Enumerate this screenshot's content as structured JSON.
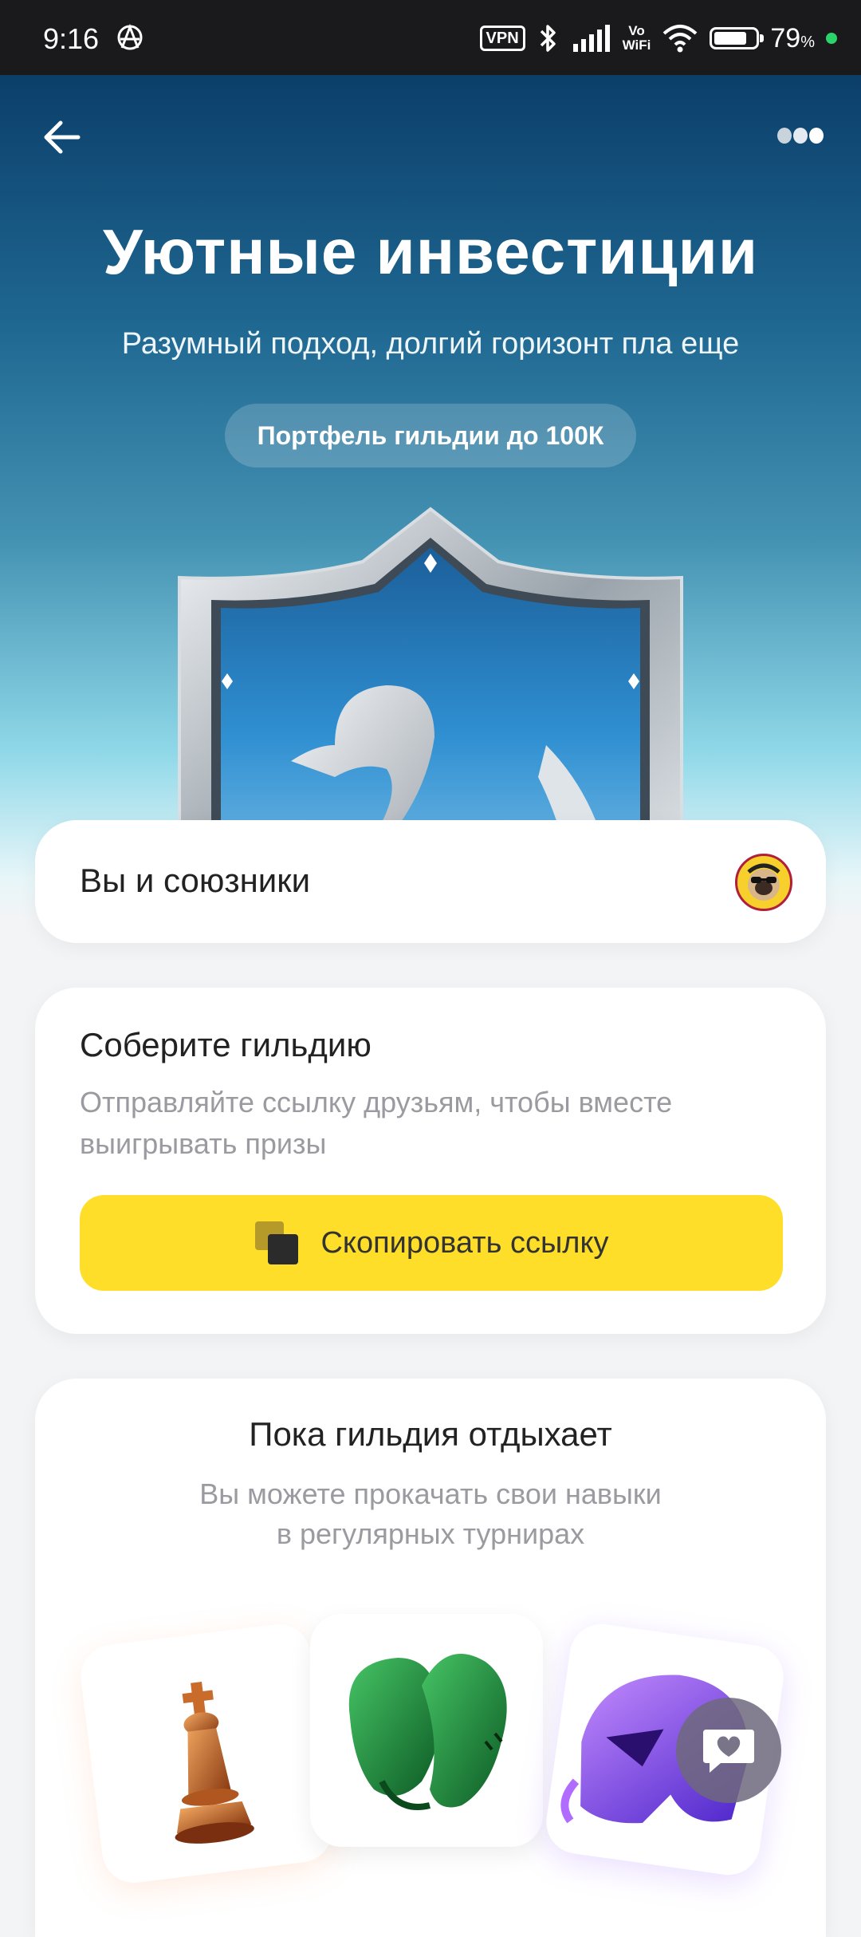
{
  "status_bar": {
    "time": "9:16",
    "vpn": "VPN",
    "vowifi_top": "Vo",
    "vowifi_bottom": "WiFi",
    "battery_percent": "79",
    "battery_unit": "%",
    "battery_level": 0.79
  },
  "hero": {
    "title": "Уютные инвестиции",
    "subtitle": "Разумный подход, долгий горизонт пла еще",
    "chip": "Портфель гильдии до 100К"
  },
  "allies": {
    "label": "Вы и союзники"
  },
  "guild": {
    "title": "Соберите гильдию",
    "description": "Отправляйте ссылку друзьям, чтобы вместе выигрывать призы",
    "copy_button": "Скопировать ссылку"
  },
  "rest": {
    "title": "Пока гильдия отдыхает",
    "description_line1": "Вы можете прокачать свои навыки",
    "description_line2": "в регулярных турнирах"
  },
  "colors": {
    "accent_yellow": "#ffde2a",
    "hero_top": "#0b3f6a",
    "hero_bottom": "#8fd8e8",
    "online_dot": "#2bd46b"
  },
  "icons": [
    "back-arrow-icon",
    "more-dots-icon",
    "shield-swan-icon",
    "copy-icon",
    "chess-king-icon",
    "boxing-gloves-icon",
    "helmet-icon",
    "chat-heart-icon"
  ]
}
